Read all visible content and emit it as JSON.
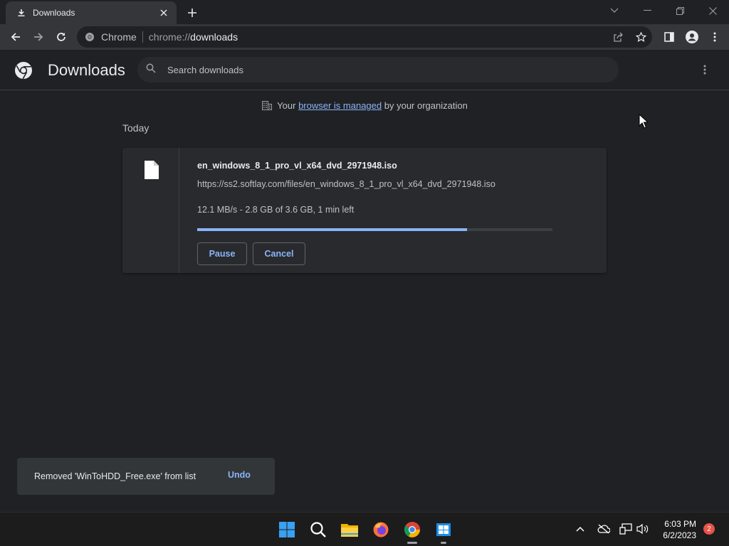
{
  "tab": {
    "title": "Downloads"
  },
  "omnibox": {
    "site_label": "Chrome",
    "scheme": "chrome://",
    "path": "downloads"
  },
  "page": {
    "title": "Downloads",
    "search_placeholder": "Search downloads"
  },
  "managed_notice": {
    "prefix": "Your",
    "link": "browser is managed",
    "suffix": "by your organization"
  },
  "section_label": "Today",
  "download": {
    "filename": "en_windows_8_1_pro_vl_x64_dvd_2971948.iso",
    "url": "https://ss2.softlay.com/files/en_windows_8_1_pro_vl_x64_dvd_2971948.iso",
    "status": "12.1 MB/s - 2.8 GB of 3.6 GB, 1 min left",
    "progress_fraction": 0.76,
    "pause_label": "Pause",
    "cancel_label": "Cancel"
  },
  "toast": {
    "message": "Removed 'WinToHDD_Free.exe' from list",
    "action": "Undo"
  },
  "taskbar": {
    "apps": [
      "start-icon",
      "search-icon",
      "file-explorer-icon",
      "firefox-icon",
      "chrome-icon",
      "app-installer-icon"
    ],
    "time": "6:03 PM",
    "date": "6/2/2023",
    "notification_count": "2"
  },
  "colors": {
    "accent": "#8ab4f8",
    "background": "#202124",
    "surface": "#292a2d",
    "toolbar": "#35363a"
  }
}
